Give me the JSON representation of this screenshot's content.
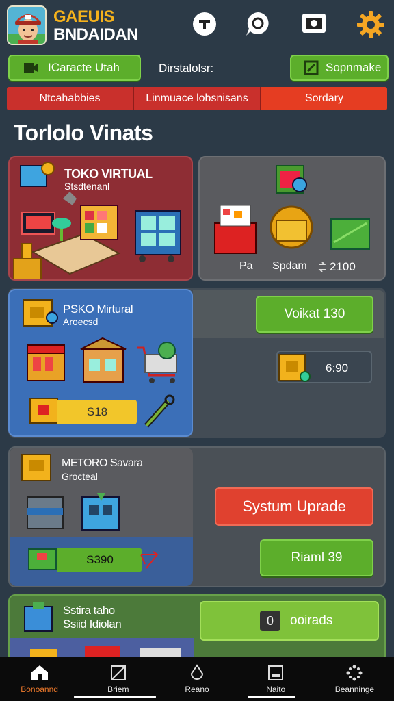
{
  "header": {
    "title_line1": "GAEUIS",
    "title_line2": "BNDAIDAN",
    "icons": [
      "t-circle-icon",
      "chat-icon",
      "camera-icon",
      "gear-icon"
    ]
  },
  "actions": {
    "left_button": "ICaracte Utah",
    "info": "Dirstalolsr:",
    "right_button": "Sopnmake"
  },
  "tabs": [
    "Ntcahabbies",
    "Linmuace lobsnisans",
    "Sordary"
  ],
  "section_title": "Torlolo Vinats",
  "cards": {
    "toko": {
      "title": "TOKO VIRTUAL",
      "subtitle": "Stsdtenanl"
    },
    "stats": {
      "label_a": "Pa",
      "label_b": "Spdam",
      "value": "2100"
    },
    "psko": {
      "title": "PSKO Mirtural",
      "subtitle": "Aroecsd",
      "price": "S18",
      "button": "Voikat 130",
      "crate_value": "6:90"
    },
    "metoro": {
      "title": "METORO Savara",
      "subtitle": "Grocteal",
      "price": "S390",
      "button_upgrade": "Systum Uprade",
      "button_green": "Riaml 39"
    },
    "sistima": {
      "title_line1": "Sstira taho",
      "title_line2": "Ssiid Idiolan",
      "button": "ooirads",
      "button_icon": "0"
    }
  },
  "nav": [
    {
      "label": "Bonoannd",
      "icon": "home-icon",
      "active": true
    },
    {
      "label": "Briem",
      "icon": "square-icon",
      "active": false
    },
    {
      "label": "Reano",
      "icon": "drop-icon",
      "active": false
    },
    {
      "label": "Naito",
      "icon": "box-icon",
      "active": false
    },
    {
      "label": "Beanninge",
      "icon": "dots-icon",
      "active": false
    }
  ],
  "colors": {
    "background": "#2c3a47",
    "accent_green": "#5cae2b",
    "accent_red": "#c9302c",
    "accent_orange": "#f07a2b",
    "title_gold": "#f5b21c"
  }
}
